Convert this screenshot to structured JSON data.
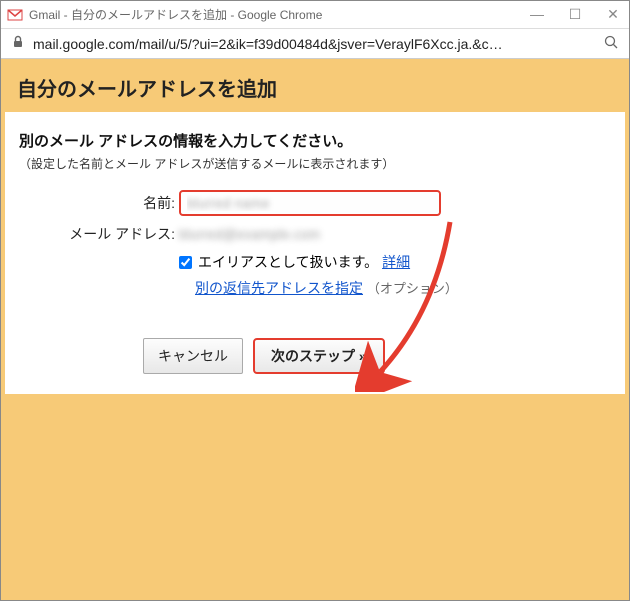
{
  "window": {
    "title": "Gmail - 自分のメールアドレスを追加 - Google Chrome"
  },
  "address": {
    "url": "mail.google.com/mail/u/5/?ui=2&ik=f39d00484d&jsver=VeraylF6Xcc.ja.&c…"
  },
  "page": {
    "title": "自分のメールアドレスを追加",
    "heading": "別のメール アドレスの情報を入力してください。",
    "subheading": "（設定した名前とメール アドレスが送信するメールに表示されます）",
    "labels": {
      "name": "名前:",
      "email": "メール アドレス:"
    },
    "name_value": "blurred name",
    "email_value": "blurred@example.com",
    "alias_label": "エイリアスとして扱います。",
    "alias_detail": "詳細",
    "reply_link": "別の返信先アドレスを指定",
    "option_note": "（オプション）",
    "buttons": {
      "cancel": "キャンセル",
      "next": "次のステップ »"
    }
  }
}
